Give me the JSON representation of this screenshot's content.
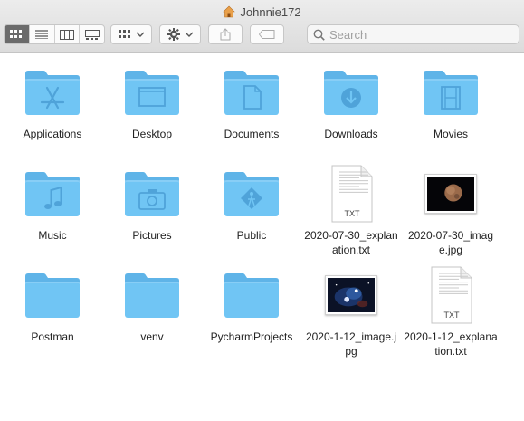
{
  "window": {
    "title": "Johnnie172"
  },
  "toolbar": {
    "view_modes": [
      "icon-view",
      "list-view",
      "column-view",
      "gallery-view"
    ],
    "active_view": "icon-view"
  },
  "search": {
    "placeholder": "Search",
    "value": ""
  },
  "colors": {
    "folder": "#70c5f4",
    "folder_dark": "#5fb4e8",
    "glyph": "#4fa3d9",
    "accent_active": "#6b6b6b"
  },
  "items": [
    {
      "label": "Applications",
      "kind": "folder",
      "glyph": "apps"
    },
    {
      "label": "Desktop",
      "kind": "folder",
      "glyph": "desktop"
    },
    {
      "label": "Documents",
      "kind": "folder",
      "glyph": "document"
    },
    {
      "label": "Downloads",
      "kind": "folder",
      "glyph": "download"
    },
    {
      "label": "Movies",
      "kind": "folder",
      "glyph": "film"
    },
    {
      "label": "Music",
      "kind": "folder",
      "glyph": "music"
    },
    {
      "label": "Pictures",
      "kind": "folder",
      "glyph": "camera"
    },
    {
      "label": "Public",
      "kind": "folder",
      "glyph": "public"
    },
    {
      "label": "2020-07-30_explanation.txt",
      "kind": "txt",
      "badge": "TXT"
    },
    {
      "label": "2020-07-30_image.jpg",
      "kind": "image",
      "image": "mars"
    },
    {
      "label": "Postman",
      "kind": "folder",
      "glyph": "none"
    },
    {
      "label": "venv",
      "kind": "folder",
      "glyph": "none"
    },
    {
      "label": "PycharmProjects",
      "kind": "folder",
      "glyph": "none"
    },
    {
      "label": "2020-1-12_image.jpg",
      "kind": "image",
      "image": "nebula"
    },
    {
      "label": "2020-1-12_explanation.txt",
      "kind": "txt",
      "badge": "TXT"
    }
  ]
}
